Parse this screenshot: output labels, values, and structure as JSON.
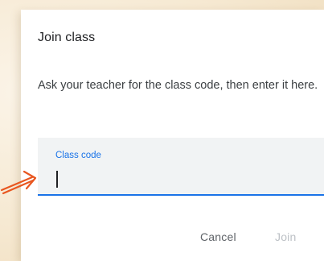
{
  "dialog": {
    "title": "Join class",
    "description": "Ask your teacher for the class code, then enter it here.",
    "field": {
      "label": "Class code",
      "value": ""
    },
    "actions": {
      "cancel_label": "Cancel",
      "join_label": "Join"
    }
  },
  "annotation": {
    "icon": "arrow-right-icon",
    "color": "#e8561f"
  },
  "colors": {
    "accent": "#1a73e8",
    "disabled": "#bdc1c6"
  }
}
